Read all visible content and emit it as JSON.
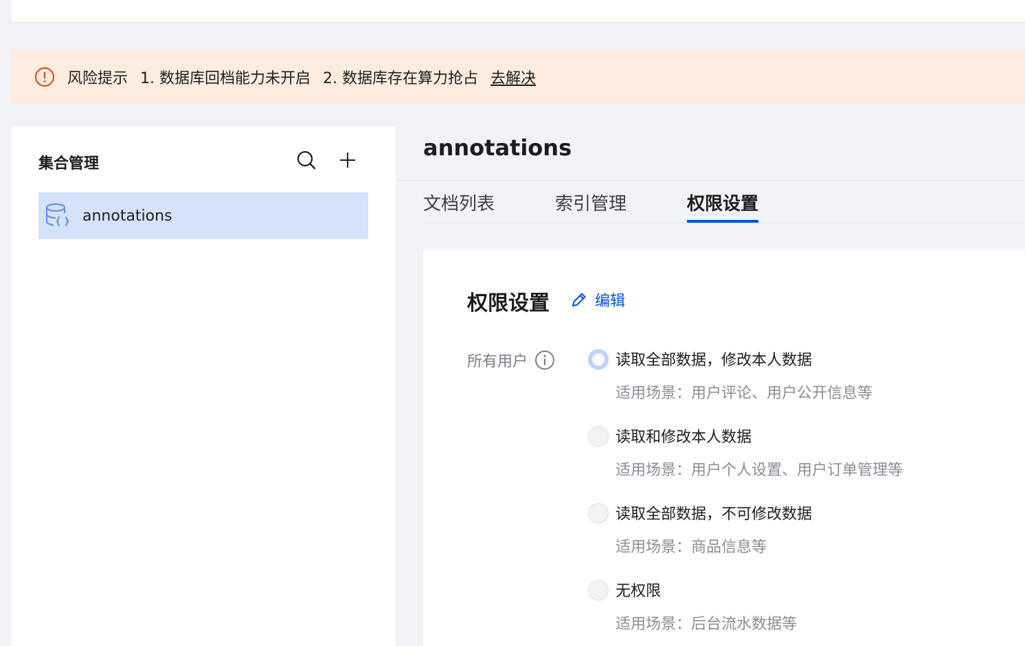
{
  "alert": {
    "title": "风险提示",
    "items": [
      "1. 数据库回档能力未开启",
      "2. 数据库存在算力抢占"
    ],
    "link": "去解决",
    "color": "#c9572b"
  },
  "sidebar": {
    "title": "集合管理",
    "items": [
      {
        "label": "annotations",
        "icon": "database-icon",
        "selected": true
      }
    ]
  },
  "main": {
    "collection_title": "annotations",
    "tabs": [
      {
        "label": "文档列表",
        "active": false
      },
      {
        "label": "索引管理",
        "active": false
      },
      {
        "label": "权限设置",
        "active": true
      }
    ]
  },
  "permissions": {
    "title": "权限设置",
    "edit_label": "编辑",
    "field_label": "所有用户",
    "options": [
      {
        "label": "读取全部数据，修改本人数据",
        "desc": "适用场景：用户评论、用户公开信息等",
        "checked": true
      },
      {
        "label": "读取和修改本人数据",
        "desc": "适用场景：用户个人设置、用户订单管理等",
        "checked": false
      },
      {
        "label": "读取全部数据，不可修改数据",
        "desc": "适用场景：商品信息等",
        "checked": false
      },
      {
        "label": "无权限",
        "desc": "适用场景：后台流水数据等",
        "checked": false
      }
    ]
  },
  "colors": {
    "accent": "#0052d9",
    "selected_bg": "#d4e2fa",
    "alert_bg": "#fdece0"
  }
}
